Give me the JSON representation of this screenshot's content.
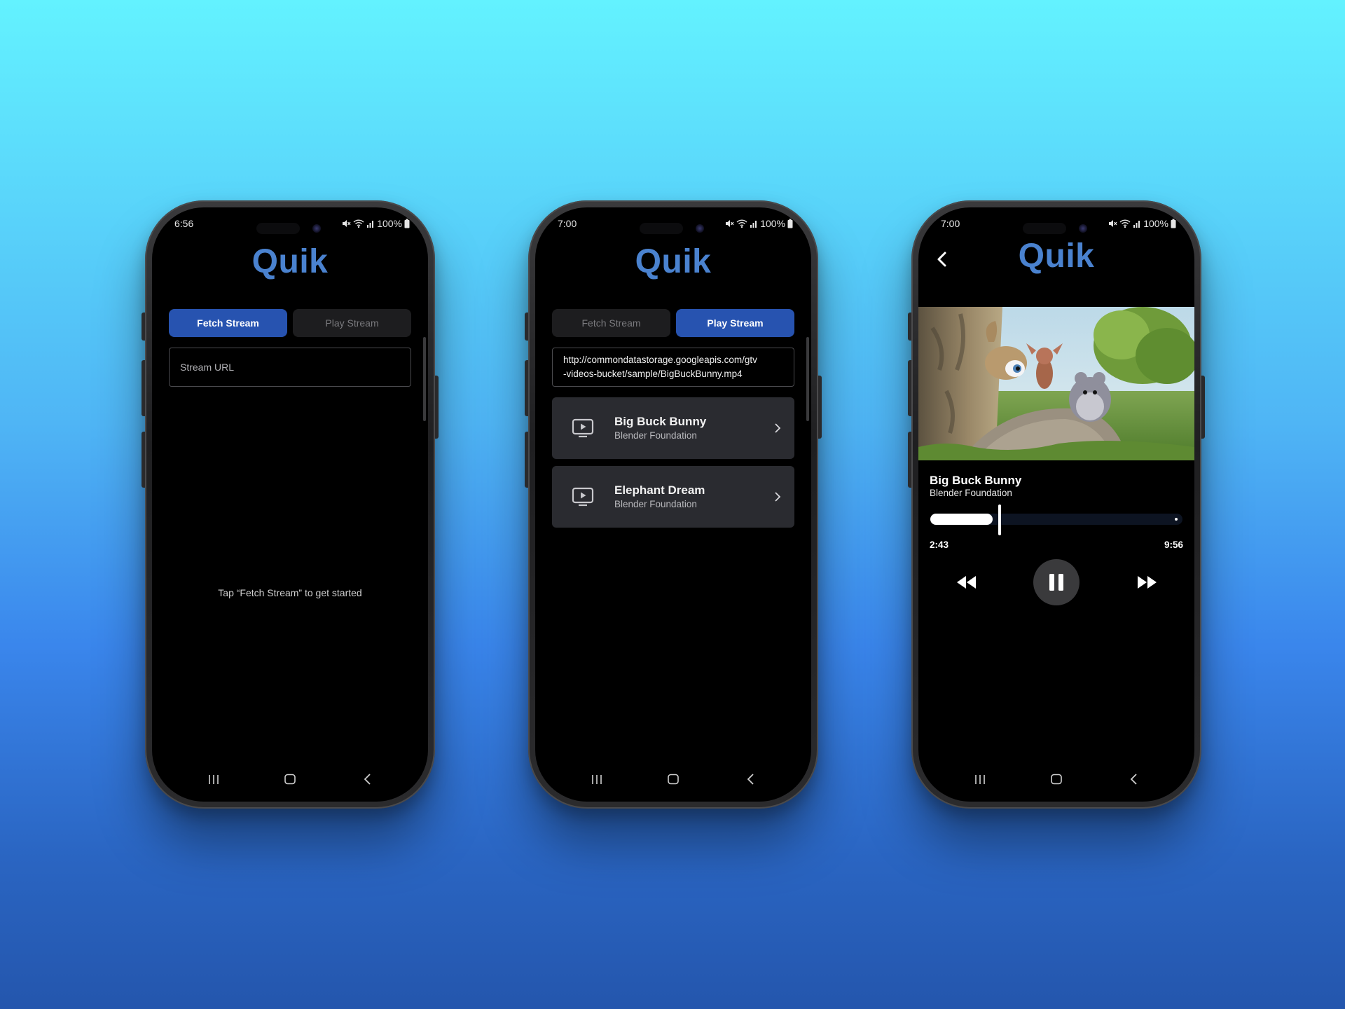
{
  "colors": {
    "background_top": "#63f2ff",
    "background_bottom": "#2456ad",
    "brand_title": "#4a82cf",
    "tab_active": "#2753b0",
    "tab_inactive": "#1d1d1f",
    "card": "#2a2b30"
  },
  "phone1": {
    "status": {
      "time": "6:56",
      "battery": "100%"
    },
    "app_title": "Quik",
    "tabs": {
      "fetch": "Fetch Stream",
      "play": "Play Stream",
      "active": "fetch"
    },
    "url_input": {
      "placeholder": "Stream URL",
      "value": ""
    },
    "hint": "Tap “Fetch Stream” to get started"
  },
  "phone2": {
    "status": {
      "time": "7:00",
      "battery": "100%"
    },
    "app_title": "Quik",
    "tabs": {
      "fetch": "Fetch Stream",
      "play": "Play Stream",
      "active": "play"
    },
    "url_input": {
      "line1": "http://commondatastorage.googleapis.com/gtv",
      "line2": "-videos-bucket/sample/BigBuckBunny.mp4"
    },
    "videos": [
      {
        "title": "Big Buck Bunny",
        "subtitle": "Blender Foundation",
        "icon": "video-icon"
      },
      {
        "title": "Elephant Dream",
        "subtitle": "Blender Foundation",
        "icon": "video-icon"
      }
    ]
  },
  "phone3": {
    "status": {
      "time": "7:00",
      "battery": "100%"
    },
    "app_title": "Quik",
    "video": {
      "title": "Big Buck Bunny",
      "subtitle": "Blender Foundation"
    },
    "playback": {
      "current": "2:43",
      "duration": "9:56",
      "progress_fraction": 0.27
    },
    "controls": [
      "rewind-icon",
      "pause-icon",
      "fast-forward-icon"
    ]
  },
  "navbar_icons": [
    "recents-icon",
    "home-icon",
    "back-icon"
  ]
}
